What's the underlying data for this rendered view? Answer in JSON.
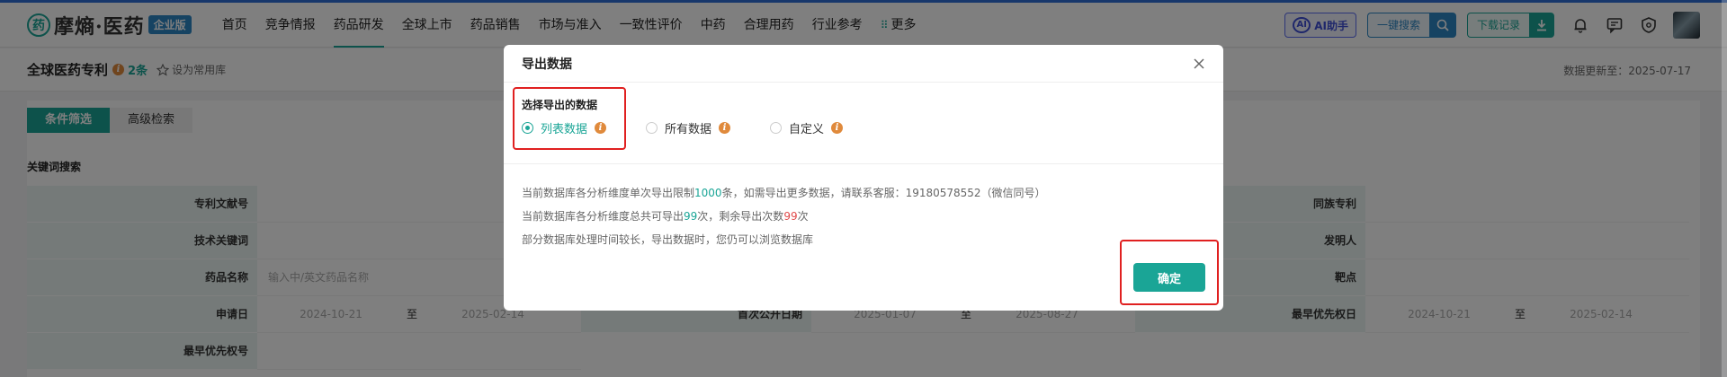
{
  "app": {
    "logo_mark": "药",
    "logo_text": "摩熵·医药",
    "edition_badge": "企业版"
  },
  "nav": {
    "items": [
      {
        "label": "首页"
      },
      {
        "label": "竞争情报"
      },
      {
        "label": "药品研发"
      },
      {
        "label": "全球上市"
      },
      {
        "label": "药品销售"
      },
      {
        "label": "市场与准入"
      },
      {
        "label": "一致性评价"
      },
      {
        "label": "中药"
      },
      {
        "label": "合理用药"
      },
      {
        "label": "行业参考"
      }
    ],
    "more_label": "更多",
    "active_index": 2
  },
  "header_right": {
    "ai_label": "AI助手",
    "ai_icon_text": "AI",
    "search_label": "一键搜索",
    "download_label": "下载记录"
  },
  "subheader": {
    "title": "全球医药专利",
    "count": "2条",
    "set_common": "设为常用库",
    "update_time": "数据更新至：2025-07-17"
  },
  "main": {
    "tabs": [
      {
        "label": "条件筛选",
        "active": true
      },
      {
        "label": "高级检索",
        "active": false
      }
    ],
    "section_label": "关键词搜索",
    "rows": [
      {
        "c1_label": "专利文献号",
        "c1_value": "",
        "c2_label": "",
        "c3_label": "同族专利",
        "c3_value": ""
      },
      {
        "c1_label": "技术关键词",
        "c1_value": "",
        "c2_label": "",
        "c3_label": "发明人",
        "c3_value": ""
      },
      {
        "c1_label": "药品名称",
        "c1_value": "输入中/英文药品名称",
        "c2_label": "",
        "c3_label": "靶点",
        "c3_value": ""
      },
      {
        "c1_label": "申请日",
        "c1_from": "2024-10-21",
        "c1_to": "至",
        "c1_until": "2025-02-14",
        "c2_label": "首次公开日期",
        "c2_from": "2025-01-07",
        "c2_to": "至",
        "c2_until": "2025-08-27",
        "c3_label": "最早优先权日",
        "c3_from": "2024-10-21",
        "c3_to": "至",
        "c3_until": "2025-02-14"
      },
      {
        "c1_label": "最早优先权号",
        "c1_value": ""
      }
    ]
  },
  "modal": {
    "title": "导出数据",
    "choose_label": "选择导出的数据",
    "options": [
      {
        "label": "列表数据",
        "checked": true
      },
      {
        "label": "所有数据",
        "checked": false
      },
      {
        "label": "自定义",
        "checked": false
      }
    ],
    "info_glyph": "i",
    "note1_a": "当前数据库各分析维度单次导出限制",
    "note1_b": "1000",
    "note1_c": "条，如需导出更多数据，请联系客服：19180578552（微信同号）",
    "note2_a": "当前数据库各分析维度总共可导出",
    "note2_b": "99",
    "note2_c": "次，剩余导出次数",
    "note2_d": "99",
    "note2_e": "次",
    "note3": "部分数据库处理时间较长，导出数据时，您仍可以浏览数据库",
    "confirm_label": "确定"
  },
  "colors": {
    "accent": "#1aa596",
    "annotation": "#e02020",
    "warning": "#e08a3c"
  }
}
